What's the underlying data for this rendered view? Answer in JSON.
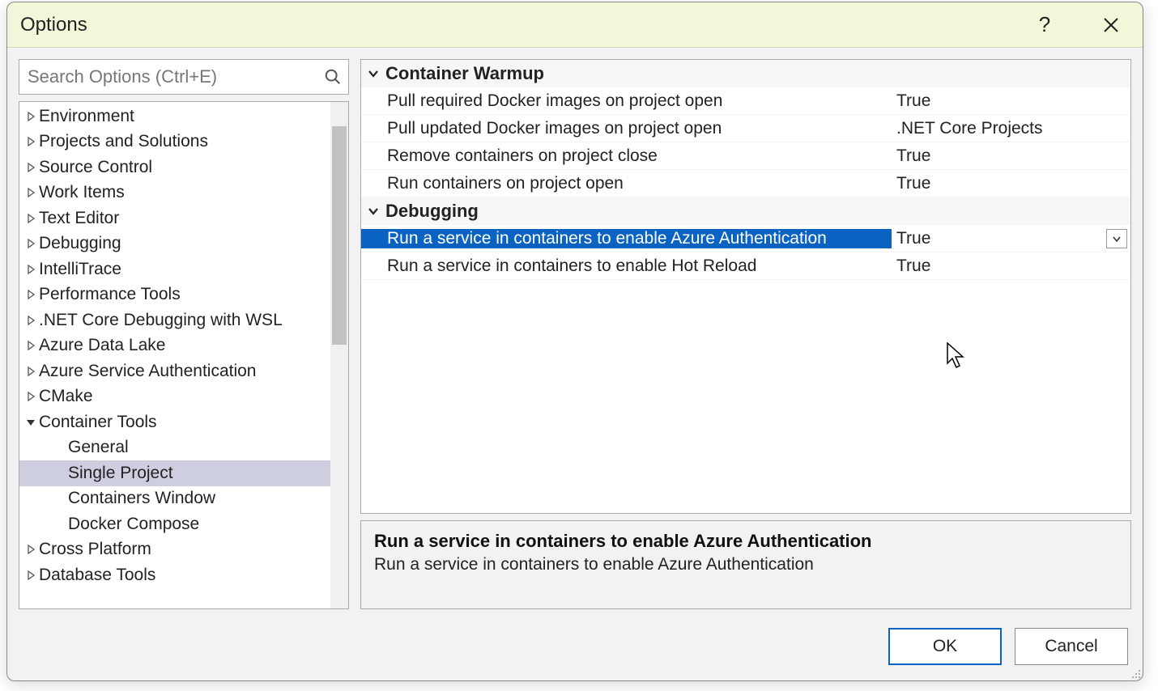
{
  "dialog": {
    "title": "Options",
    "help_tooltip": "?",
    "close_tooltip": "Close"
  },
  "search": {
    "placeholder": "Search Options (Ctrl+E)"
  },
  "tree": {
    "items": [
      {
        "label": "Environment",
        "expanded": false,
        "child": false
      },
      {
        "label": "Projects and Solutions",
        "expanded": false,
        "child": false
      },
      {
        "label": "Source Control",
        "expanded": false,
        "child": false
      },
      {
        "label": "Work Items",
        "expanded": false,
        "child": false
      },
      {
        "label": "Text Editor",
        "expanded": false,
        "child": false
      },
      {
        "label": "Debugging",
        "expanded": false,
        "child": false
      },
      {
        "label": "IntelliTrace",
        "expanded": false,
        "child": false
      },
      {
        "label": "Performance Tools",
        "expanded": false,
        "child": false
      },
      {
        "label": ".NET Core Debugging with WSL",
        "expanded": false,
        "child": false
      },
      {
        "label": "Azure Data Lake",
        "expanded": false,
        "child": false
      },
      {
        "label": "Azure Service Authentication",
        "expanded": false,
        "child": false
      },
      {
        "label": "CMake",
        "expanded": false,
        "child": false
      },
      {
        "label": "Container Tools",
        "expanded": true,
        "child": false
      },
      {
        "label": "General",
        "expanded": false,
        "child": true
      },
      {
        "label": "Single Project",
        "expanded": false,
        "child": true,
        "selected": true
      },
      {
        "label": "Containers Window",
        "expanded": false,
        "child": true
      },
      {
        "label": "Docker Compose",
        "expanded": false,
        "child": true
      },
      {
        "label": "Cross Platform",
        "expanded": false,
        "child": false
      },
      {
        "label": "Database Tools",
        "expanded": false,
        "child": false
      }
    ]
  },
  "propgrid": {
    "categories": [
      {
        "name": "Container Warmup",
        "props": [
          {
            "label": "Pull required Docker images on project open",
            "value": "True"
          },
          {
            "label": "Pull updated Docker images on project open",
            "value": ".NET Core Projects"
          },
          {
            "label": "Remove containers on project close",
            "value": "True"
          },
          {
            "label": "Run containers on project open",
            "value": "True"
          }
        ]
      },
      {
        "name": "Debugging",
        "props": [
          {
            "label": "Run a service in containers to enable Azure Authentication",
            "value": "True",
            "selected": true
          },
          {
            "label": "Run a service in containers to enable Hot Reload",
            "value": "True"
          }
        ]
      }
    ]
  },
  "description": {
    "title": "Run a service in containers to enable Azure Authentication",
    "text": "Run a service in containers to enable Azure Authentication"
  },
  "footer": {
    "ok": "OK",
    "cancel": "Cancel"
  }
}
